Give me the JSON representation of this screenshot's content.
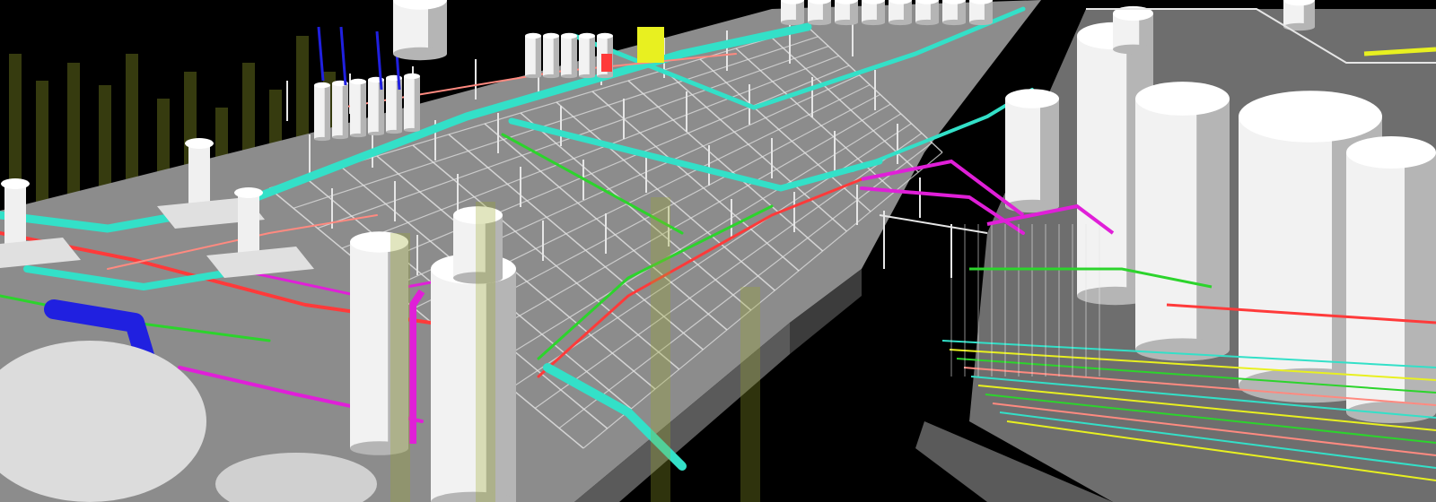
{
  "scene": {
    "background": "#000000",
    "palette": {
      "floor": "#8c8c8c",
      "floor_dark": "#5a5a5a",
      "floor_side": "#3c3c3c",
      "tank": "#f2f2f2",
      "tank_shade": "#b5b5b5",
      "steel": "#e6e6e6",
      "cyan": "#33e0c8",
      "magenta": "#e01fd8",
      "red": "#ff3a3a",
      "green": "#2cd42c",
      "blue": "#2020e0",
      "yellow": "#e8f020",
      "salmon": "#ff8a80",
      "ghost_column": "#9aa82a"
    }
  }
}
